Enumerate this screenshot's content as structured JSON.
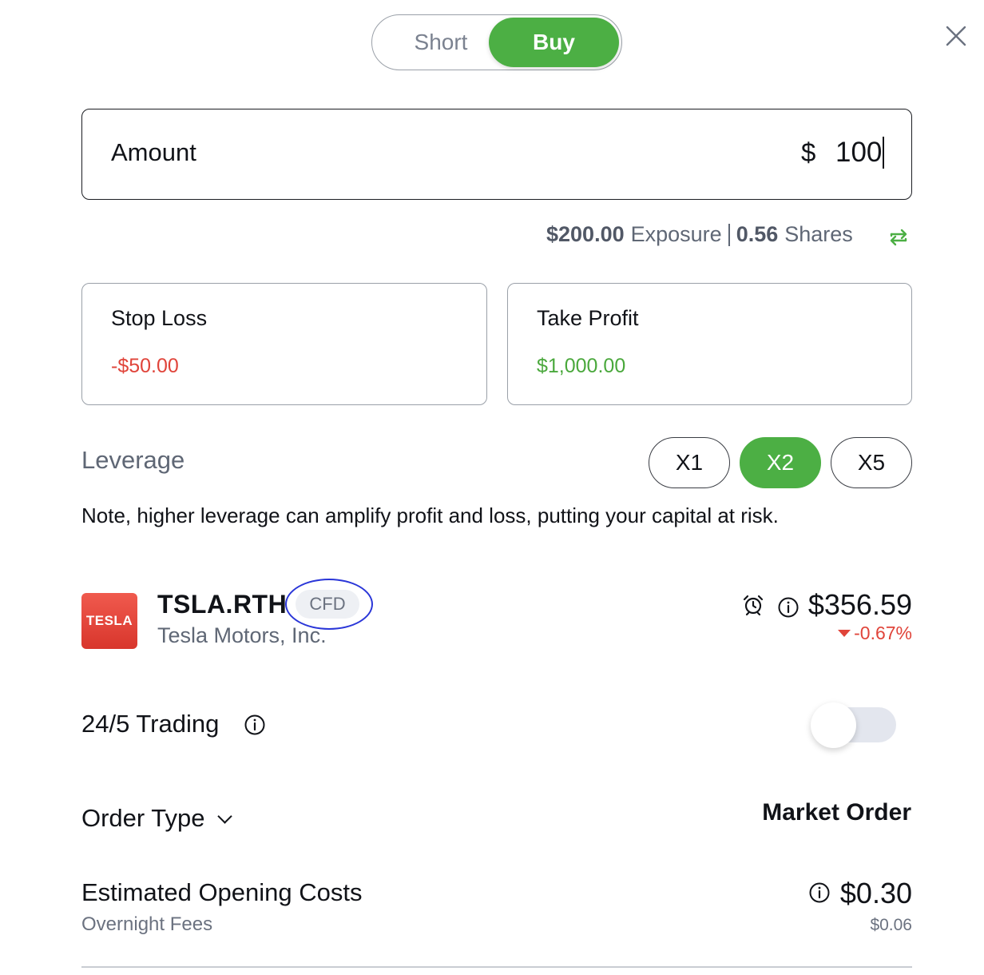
{
  "side_toggle": {
    "short_label": "Short",
    "buy_label": "Buy",
    "selected": "Buy"
  },
  "amount": {
    "label": "Amount",
    "currency": "$",
    "value": "100"
  },
  "exposure": {
    "exposure_value": "$200.00",
    "exposure_label": "Exposure",
    "shares_value": "0.56",
    "shares_label": "Shares"
  },
  "stop_loss": {
    "title": "Stop Loss",
    "value": "-$50.00"
  },
  "take_profit": {
    "title": "Take Profit",
    "value": "$1,000.00"
  },
  "leverage": {
    "label": "Leverage",
    "options": [
      "X1",
      "X2",
      "X5"
    ],
    "selected": "X2",
    "note": "Note, higher leverage can amplify profit and loss, putting your capital at risk."
  },
  "instrument": {
    "logo_text": "TESLA",
    "ticker": "TSLA.RTH",
    "badge": "CFD",
    "company": "Tesla Motors, Inc.",
    "price": "$356.59",
    "change": "-0.67%"
  },
  "trading_24_5": {
    "label": "24/5 Trading",
    "enabled": false
  },
  "order_type": {
    "label": "Order Type",
    "value": "Market Order"
  },
  "opening_costs": {
    "label": "Estimated Opening Costs",
    "value": "$0.30",
    "sub_label": "Overnight Fees",
    "sub_value": "$0.06"
  },
  "colors": {
    "accent_green": "#4caf44",
    "negative_red": "#e0443a",
    "highlight_ring": "#2a36d8"
  }
}
